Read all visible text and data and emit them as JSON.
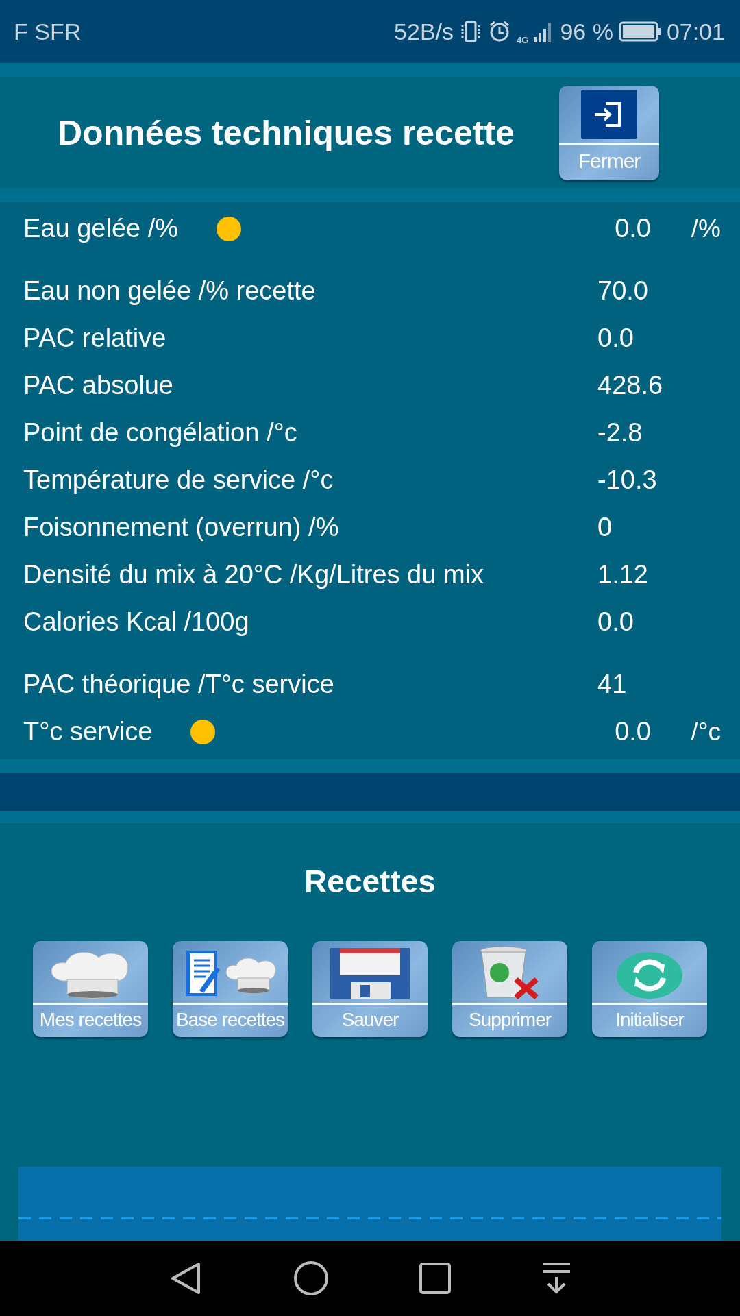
{
  "status_bar": {
    "carrier": "F SFR",
    "speed": "52B/s",
    "network": "4G",
    "battery": "96 %",
    "time": "07:01"
  },
  "header": {
    "title": "Données techniques recette",
    "close_button": "Fermer"
  },
  "data_groups": [
    [
      {
        "kind": "input",
        "label": "Eau gelée /%",
        "value": "0.0",
        "unit": "/%"
      }
    ],
    [
      {
        "kind": "plain",
        "label": "Eau non gelée /% recette",
        "value": "70.0"
      },
      {
        "kind": "plain",
        "label": "PAC relative",
        "value": "0.0"
      },
      {
        "kind": "plain",
        "label": "PAC absolue",
        "value": "428.6"
      },
      {
        "kind": "plain",
        "label": "Point de congélation /°c",
        "value": "-2.8"
      },
      {
        "kind": "plain",
        "label": "Température de service /°c",
        "value": "-10.3"
      },
      {
        "kind": "plain",
        "label": "Foisonnement (overrun) /%",
        "value": "0"
      },
      {
        "kind": "plain",
        "label": "Densité du mix à 20°C /Kg/Litres du mix",
        "value": "1.12"
      },
      {
        "kind": "plain",
        "label": "Calories  Kcal /100g",
        "value": "0.0"
      }
    ],
    [
      {
        "kind": "plain",
        "label": "PAC théorique /T°c service",
        "value": "41"
      },
      {
        "kind": "input",
        "label": "T°c service",
        "value": "0.0",
        "unit": "/°c"
      }
    ]
  ],
  "recipes": {
    "title": "Recettes",
    "buttons": [
      {
        "kind": "hat",
        "label": "Mes recettes"
      },
      {
        "kind": "notebook_hat",
        "label": "Base recettes"
      },
      {
        "kind": "floppy",
        "label": "Sauver"
      },
      {
        "kind": "trash",
        "label": "Supprimer"
      },
      {
        "kind": "refresh",
        "label": "Initialiser"
      }
    ]
  }
}
